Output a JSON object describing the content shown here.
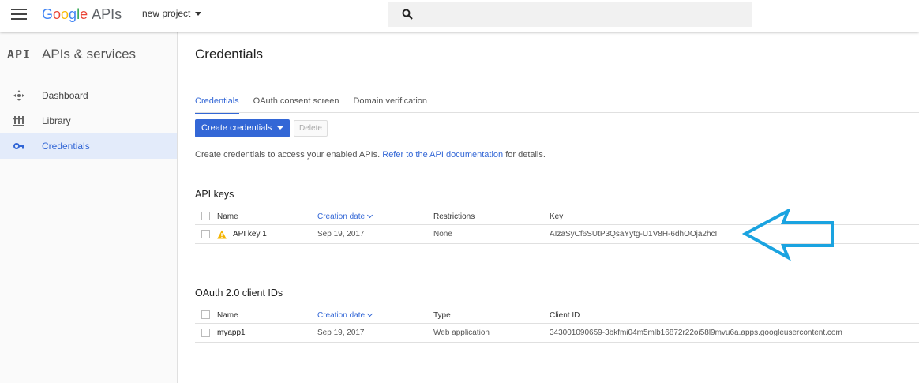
{
  "topbar": {
    "logo_letters": [
      "G",
      "o",
      "o",
      "g",
      "l",
      "e"
    ],
    "logo_suffix": "APIs",
    "project": "new project"
  },
  "sidebar": {
    "badge": "API",
    "title": "APIs & services",
    "items": [
      {
        "label": "Dashboard",
        "icon": "dashboard-icon"
      },
      {
        "label": "Library",
        "icon": "library-icon"
      },
      {
        "label": "Credentials",
        "icon": "key-icon",
        "active": true
      }
    ]
  },
  "main": {
    "title": "Credentials",
    "tabs": [
      "Credentials",
      "OAuth consent screen",
      "Domain verification"
    ],
    "create_button": "Create credentials",
    "delete_button": "Delete",
    "description": {
      "before": "Create credentials to access your enabled APIs.",
      "link": "Refer to the API documentation",
      "after": "for details."
    },
    "api_keys": {
      "title": "API keys",
      "columns": [
        "Name",
        "Creation date",
        "Restrictions",
        "Key"
      ],
      "rows": [
        {
          "name": "API key 1",
          "date": "Sep 19, 2017",
          "restrictions": "None",
          "key": "AIzaSyCf6SUtP3QsaYytg-U1V8H-6dhOOja2hcI"
        }
      ]
    },
    "oauth": {
      "title": "OAuth 2.0 client IDs",
      "columns": [
        "Name",
        "Creation date",
        "Type",
        "Client ID"
      ],
      "rows": [
        {
          "name": "myapp1",
          "date": "Sep 19, 2017",
          "type": "Web application",
          "client_id": "343001090659-3bkfmi04m5mlb16872r22oi58l9mvu6a.apps.googleusercontent.com"
        }
      ]
    }
  },
  "colors": {
    "accent": "#3367d6",
    "annotation_arrow": "#1aa3e0",
    "warning": "#f4b400"
  }
}
